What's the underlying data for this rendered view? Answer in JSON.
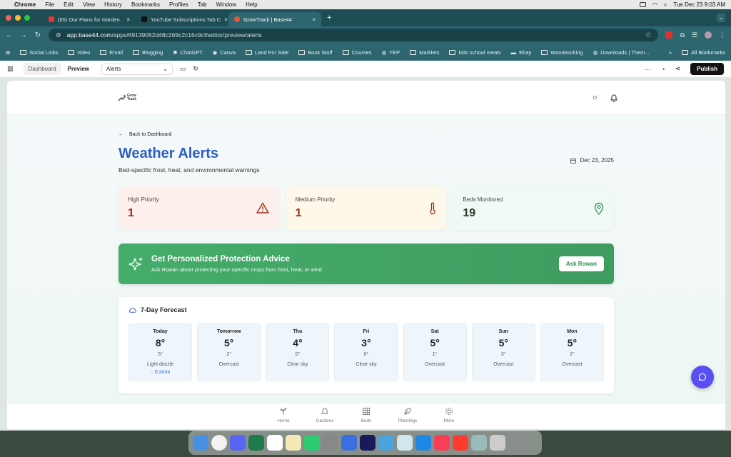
{
  "menubar": {
    "items": [
      "Chrome",
      "File",
      "Edit",
      "View",
      "History",
      "Bookmarks",
      "Profiles",
      "Tab",
      "Window",
      "Help"
    ],
    "clock": "Tue Dec 23  9:03 AM"
  },
  "browser": {
    "tabs": [
      {
        "title": "(65) Our Plans for Garden",
        "color": "#e33"
      },
      {
        "title": "YouTube Subscriptions Tab C",
        "color": "#222"
      },
      {
        "title": "GrowTrack | Base44",
        "color": "#e8553b"
      }
    ],
    "url_host": "app.base44.com",
    "url_path": "/apps/69139062d48c269c2c16c9cf/editor/preview/alerts",
    "bookmarks": [
      "Social Links",
      "video",
      "Email",
      "Blogging",
      "ChatGPT",
      "Canva",
      "Land For Sale",
      "Book Stuff",
      "Courses",
      "YEP",
      "Marklets",
      "kids school meals",
      "Ebay",
      "Woodworking",
      "Downloads | Them..."
    ],
    "all_bookmarks": "All Bookmarks"
  },
  "editor": {
    "dashboard": "Dashboard",
    "preview": "Preview",
    "page_select": "Alerts",
    "publish": "Publish"
  },
  "app": {
    "logo": "Grow Track",
    "back": "Back to Dashboard",
    "title": "Weather Alerts",
    "subtitle": "Bed-specific frost, heat, and environmental warnings",
    "date": "Dec 23, 2025",
    "stats": [
      {
        "label": "High Priority",
        "value": "1"
      },
      {
        "label": "Medium Priority",
        "value": "1"
      },
      {
        "label": "Beds Monitored",
        "value": "19"
      }
    ],
    "promo": {
      "heading": "Get Personalized Protection Advice",
      "sub": "Ask Rowan about protecting your specific crops from frost, heat, or wind",
      "button": "Ask Rowan"
    },
    "forecast": {
      "heading": "7-Day Forecast",
      "days": [
        {
          "day": "Today",
          "high": "8°",
          "low": "5°",
          "cond": "Light drizzle",
          "rain": "0.2mm"
        },
        {
          "day": "Tomorrow",
          "high": "5°",
          "low": "2°",
          "cond": "Overcast"
        },
        {
          "day": "Thu",
          "high": "4°",
          "low": "0°",
          "cond": "Clear sky"
        },
        {
          "day": "Fri",
          "high": "3°",
          "low": "0°",
          "cond": "Clear sky"
        },
        {
          "day": "Sat",
          "high": "5°",
          "low": "1°",
          "cond": "Overcast"
        },
        {
          "day": "Sun",
          "high": "5°",
          "low": "3°",
          "cond": "Overcast"
        },
        {
          "day": "Mon",
          "high": "5°",
          "low": "2°",
          "cond": "Overcast"
        }
      ]
    },
    "nav": [
      "Home",
      "Gardens",
      "Beds",
      "Plantings",
      "More"
    ]
  },
  "colors": {
    "accent_blue": "#2b5fc7",
    "promo_green": "#45ad6b",
    "danger": "#a22b18",
    "fab": "#5a4ff0"
  }
}
